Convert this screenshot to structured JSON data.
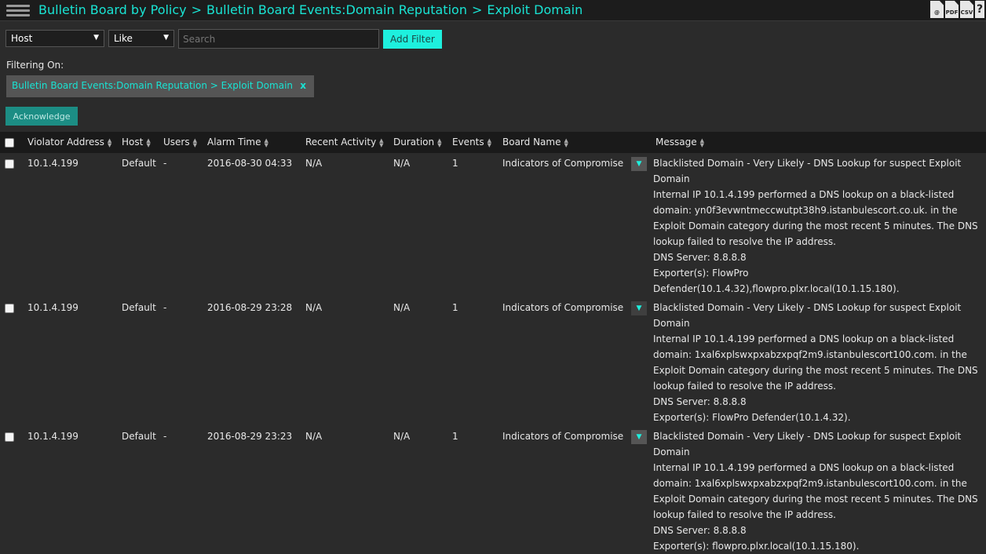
{
  "header": {
    "crumbs": [
      "Bulletin Board by Policy",
      "Bulletin Board Events:Domain Reputation",
      "Exploit Domain"
    ],
    "separator": ">",
    "exports": [
      "@",
      "PDF",
      "CSV",
      "?"
    ]
  },
  "filter_bar": {
    "field_select": "Host",
    "operator_select": "Like",
    "search_placeholder": "Search",
    "add_filter_label": "Add Filter"
  },
  "filtering": {
    "label": "Filtering On:",
    "chip_label": "Bulletin Board Events:Domain Reputation > Exploit Domain",
    "chip_remove": "x"
  },
  "actions": {
    "acknowledge_label": "Acknowledge"
  },
  "table": {
    "columns": [
      "Violator Address",
      "Host",
      "Users",
      "Alarm Time",
      "Recent Activity",
      "Duration",
      "Events",
      "Board Name",
      "Message"
    ],
    "rows": [
      {
        "violator": "10.1.4.199",
        "host": "Default",
        "users": "-",
        "alarm_time": "2016-08-30 04:33",
        "recent_activity": "N/A",
        "duration": "N/A",
        "events": "1",
        "board": "Indicators of Compromise",
        "msg_title": "Blacklisted Domain - Very Likely - DNS Lookup for suspect Exploit Domain",
        "msg_body": "Internal IP 10.1.4.199 performed a DNS lookup on a black-listed domain: yn0f3evwntmeccwutpt38h9.istanbulescort.co.uk. in the Exploit Domain category during the most recent 5 minutes. The DNS lookup failed to resolve the IP address.",
        "msg_dns": "DNS Server: 8.8.8.8",
        "msg_exporters": "Exporter(s): FlowPro Defender(10.1.4.32),flowpro.plxr.local(10.1.15.180)."
      },
      {
        "violator": "10.1.4.199",
        "host": "Default",
        "users": "-",
        "alarm_time": "2016-08-29 23:28",
        "recent_activity": "N/A",
        "duration": "N/A",
        "events": "1",
        "board": "Indicators of Compromise",
        "msg_title": "Blacklisted Domain - Very Likely - DNS Lookup for suspect Exploit Domain",
        "msg_body": "Internal IP 10.1.4.199 performed a DNS lookup on a black-listed domain: 1xal6xplswxpxabzxpqf2m9.istanbulescort100.com. in the Exploit Domain category during the most recent 5 minutes. The DNS lookup failed to resolve the IP address.",
        "msg_dns": "DNS Server: 8.8.8.8",
        "msg_exporters": "Exporter(s): FlowPro Defender(10.1.4.32)."
      },
      {
        "violator": "10.1.4.199",
        "host": "Default",
        "users": "-",
        "alarm_time": "2016-08-29 23:23",
        "recent_activity": "N/A",
        "duration": "N/A",
        "events": "1",
        "board": "Indicators of Compromise",
        "msg_title": "Blacklisted Domain - Very Likely - DNS Lookup for suspect Exploit Domain",
        "msg_body": "Internal IP 10.1.4.199 performed a DNS lookup on a black-listed domain: 1xal6xplswxpxabzxpqf2m9.istanbulescort100.com. in the Exploit Domain category during the most recent 5 minutes. The DNS lookup failed to resolve the IP address.",
        "msg_dns": "DNS Server: 8.8.8.8",
        "msg_exporters": "Exporter(s): flowpro.plxr.local(10.1.15.180)."
      }
    ]
  },
  "colors": {
    "accent": "#19e3d3",
    "button": "#1ef0de",
    "ack": "#1c8d84",
    "background": "#2b2b2b",
    "header": "#1a1a1a"
  },
  "icons": {
    "menu": "hamburger-icon",
    "row_menu": "triangle-down-icon",
    "sort": "sort-arrows-icon"
  }
}
